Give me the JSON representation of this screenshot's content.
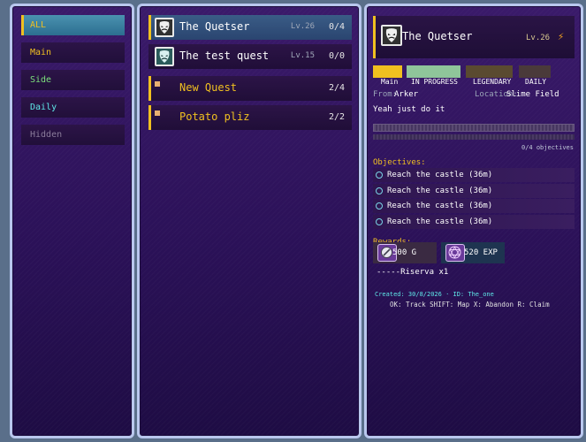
{
  "categories": [
    {
      "label": "ALL",
      "color": "#f0c020",
      "selected": true
    },
    {
      "label": "Main",
      "color": "#f0c020"
    },
    {
      "label": "Side",
      "color": "#7ce07c"
    },
    {
      "label": "Daily",
      "color": "#5fe8e8"
    },
    {
      "label": "Hidden",
      "color": "#8a7c9a"
    }
  ],
  "quests": [
    {
      "name": "The Quetser",
      "level": "Lv.26",
      "progress": "0/4",
      "selected": true,
      "icon": "mask-icon"
    },
    {
      "name": "The test quest",
      "level": "Lv.15",
      "progress": "0/0",
      "icon": "mask-icon"
    },
    {
      "name": "New Quest",
      "level": "",
      "progress": "2/4"
    },
    {
      "name": "Potato pliz",
      "level": "",
      "progress": "2/2"
    }
  ],
  "detail": {
    "title": "The Quetser",
    "level": "Lv.26",
    "tags": [
      {
        "label": "Main",
        "color": "#f0c020"
      },
      {
        "label": "IN PROGRESS",
        "color": "#8fc59a"
      },
      {
        "label": "LEGENDARY",
        "color": "#5a4a30"
      },
      {
        "label": "DAILY",
        "color": "#4a3a3a"
      }
    ],
    "from_label": "From:",
    "from_value": "Arker",
    "location_label": "Location:",
    "location_value": "Slime Field",
    "description": "Yeah just do it",
    "progress": 0,
    "objectives_count": "0/4 objectives",
    "objectives_header": "Objectives:",
    "objectives": [
      "Reach the castle  (36m)",
      "Reach the castle  (36m)",
      "Reach the castle  (36m)",
      "Reach the castle  (36m)"
    ],
    "rewards_header": "Rewards:",
    "rewards": [
      {
        "label": "500 G",
        "icon": "coin-icon"
      },
      {
        "label": "520 EXP",
        "icon": "magic-circle-icon"
      }
    ],
    "reward_item": "-----Riserva x1",
    "meta": "Created: 30/8/2026  ·  ID: The_one",
    "controls": "OK: Track  SHIFT: Map  X: Abandon  R: Claim"
  }
}
